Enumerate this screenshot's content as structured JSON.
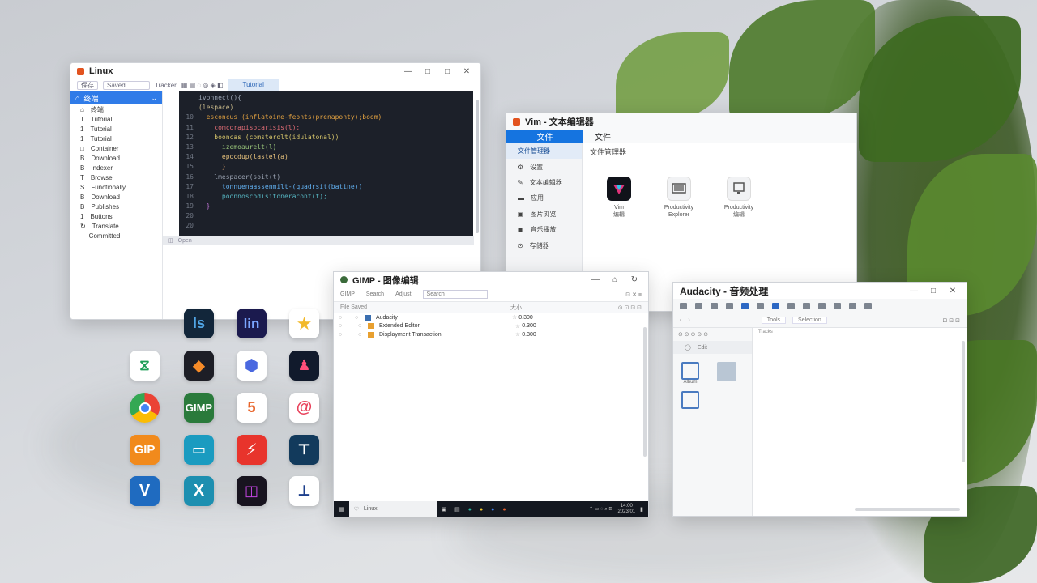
{
  "editor": {
    "title": "Linux",
    "toolbar": {
      "item1": "保存",
      "item2": "Saved",
      "item3": "Tracker",
      "tab": "Tutorial"
    },
    "sidebar": {
      "header": "终端",
      "items": [
        "终端",
        "Tutorial",
        "Tutorial",
        "Tutorial",
        "Container",
        "Download",
        "Indexer",
        "Browse",
        "Functionally",
        "Download",
        "Publishes",
        "Buttons",
        "Translate",
        "Committed"
      ]
    },
    "code": [
      {
        "n": "",
        "t": "ivonnect(){"
      },
      {
        "n": "",
        "t": "(lespace)"
      },
      {
        "n": "10",
        "t": "  esconcus (inflatoine-feonts(prenaponty);boom)"
      },
      {
        "n": "11",
        "t": "    comcorapisocarisis(l);"
      },
      {
        "n": "12",
        "t": "    booncas (comsterolt(idulatonal))"
      },
      {
        "n": "13",
        "t": "      izemoaurelt(l)"
      },
      {
        "n": "14",
        "t": "      epocdup(lastel(a)"
      },
      {
        "n": "15",
        "t": "      }"
      },
      {
        "n": "16",
        "t": "    lmespacer(soit(t)"
      },
      {
        "n": "17",
        "t": "      tonnuenaassenmilt-(quadrsit(batine))"
      },
      {
        "n": "18",
        "t": "      poonnoscodisitoneracont(t);"
      },
      {
        "n": "19",
        "t": "  }"
      },
      {
        "n": "20",
        "t": ""
      },
      {
        "n": "20",
        "t": ""
      }
    ],
    "status": "Open"
  },
  "vim": {
    "title": "Vim - 文本编辑器",
    "nav": [
      "文件",
      "文件"
    ],
    "sidebar": [
      "文件管理器",
      "设置",
      "文本编辑器",
      "应用",
      "图片浏览",
      "音乐播放",
      "存储器"
    ],
    "content_title": "文件管理器",
    "apps": [
      {
        "label": "Vim",
        "sub": "编辑"
      },
      {
        "label": "Productivity",
        "sub": "Explorer"
      },
      {
        "label": "Productivity",
        "sub": "编辑"
      }
    ]
  },
  "gimp": {
    "title": "GIMP - 图像编辑",
    "toolbar": [
      "GIMP",
      "Search",
      "Adjust"
    ],
    "search_placeholder": "Search",
    "col_name": "File Saved",
    "col_value": "大小",
    "rows": [
      {
        "name": "Audacity",
        "value": "0.300",
        "color": "#3b6fb0"
      },
      {
        "name": "Extended Editor",
        "value": "0.300",
        "color": "#e8a030"
      },
      {
        "name": "Displayment Transaction",
        "value": "0.300",
        "color": "#e8a030"
      }
    ],
    "taskbar_search": "Linux",
    "clock": "14:00",
    "date": "2023/01"
  },
  "audacity": {
    "title": "Audacity - 音频处理",
    "track_label": "Tracks",
    "tab1": "Tools",
    "tab2": "Selection",
    "left_item": "Edit",
    "left_btn": "Album"
  },
  "colors": {
    "accent": "#1574e0",
    "code_bg": "#1c2029",
    "editor_accent": "#2f7be8"
  }
}
